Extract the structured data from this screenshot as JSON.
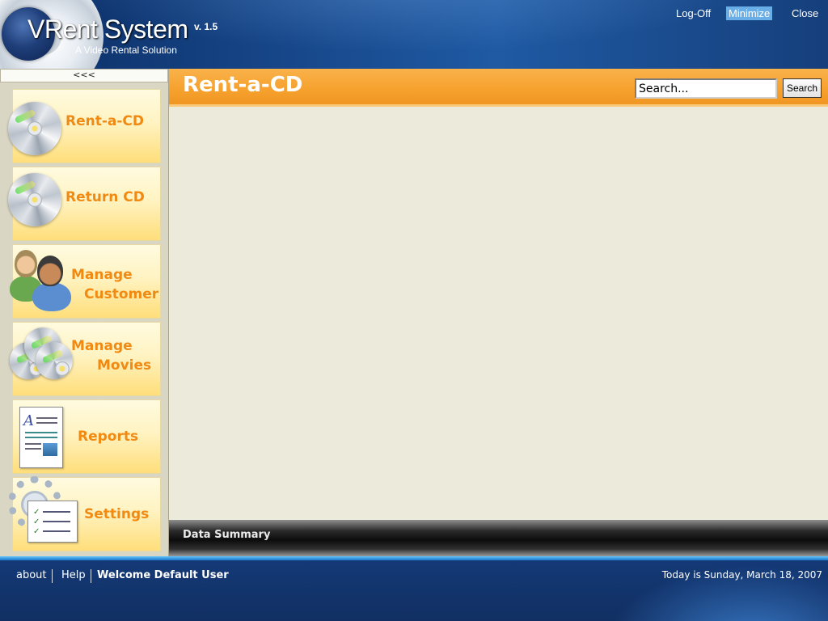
{
  "app": {
    "name": "VRent System",
    "version": "v. 1.5",
    "tagline": "A Video Rental Solution"
  },
  "window_controls": [
    {
      "label": "Log-Off"
    },
    {
      "label": "Minimize",
      "active": true
    },
    {
      "label": "Close"
    }
  ],
  "sidebar": {
    "collapse_label": "<<<",
    "items": [
      {
        "line1": "Rent-a-CD",
        "line2": "",
        "icon": "cd-icon"
      },
      {
        "line1": "Return CD",
        "line2": "",
        "icon": "cd-icon"
      },
      {
        "line1": "Manage",
        "line2": "Customer",
        "icon": "customers-icon"
      },
      {
        "line1": "Manage",
        "line2": "Movies",
        "icon": "movies-icon"
      },
      {
        "line1": "Reports",
        "line2": "",
        "icon": "report-document-icon"
      },
      {
        "line1": "Settings",
        "line2": "",
        "icon": "settings-gear-icon"
      }
    ]
  },
  "main": {
    "title": "Rent-a-CD",
    "search": {
      "value": "Search...",
      "button_label": "Search"
    },
    "summary_title": "Data Summary"
  },
  "footer": {
    "about_label": "about",
    "help_label": "Help",
    "welcome_text": "Welcome Default User",
    "date_text": "Today is Sunday, March 18, 2007"
  },
  "colors": {
    "header_blue": "#17478a",
    "accent_orange": "#f6a12e",
    "nav_text_orange": "#f08a12",
    "content_bg": "#eceadb",
    "minimize_highlight": "#6aaee8"
  }
}
